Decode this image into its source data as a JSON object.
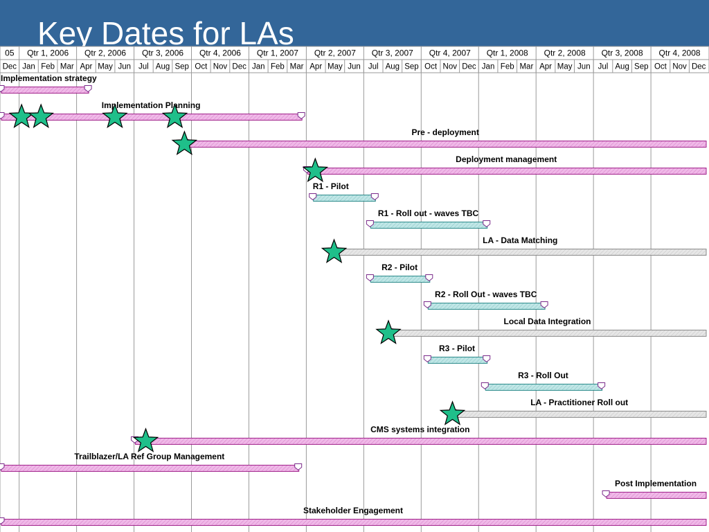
{
  "slide": {
    "title": "Key Dates for LAs"
  },
  "colors": {
    "title_bar": "#336699",
    "title_text": "#ffffff",
    "grid": "#9a9a9a",
    "strategic_fill": "#f0b8e8",
    "strategic_stroke": "#a0208a",
    "release_fill": "#bfe6e6",
    "release_stroke": "#2a8a8a",
    "local_fill": "#e6e6e6",
    "local_stroke": "#8a8a8a",
    "milestone_fill": "#1fbf8a",
    "milestone_stroke": "#000000"
  },
  "chart_data": {
    "type": "gantt",
    "title": "Key Dates for LAs",
    "quarter_labels": [
      "05",
      "Qtr 1, 2006",
      "Qtr 2, 2006",
      "Qtr 3, 2006",
      "Qtr 4, 2006",
      "Qtr 1, 2007",
      "Qtr 2, 2007",
      "Qtr 3, 2007",
      "Qtr 4, 2007",
      "Qtr 1, 2008",
      "Qtr 2, 2008",
      "Qtr 3, 2008",
      "Qtr 4, 2008"
    ],
    "month_labels": [
      "Dec",
      "Jan",
      "Feb",
      "Mar",
      "Apr",
      "May",
      "Jun",
      "Jul",
      "Aug",
      "Sep",
      "Oct",
      "Nov",
      "Dec",
      "Jan",
      "Feb",
      "Mar",
      "Apr",
      "May",
      "Jun",
      "Jul",
      "Aug",
      "Sep",
      "Oct",
      "Nov",
      "Dec",
      "Jan",
      "Feb",
      "Mar",
      "Apr",
      "May",
      "Jun",
      "Jul",
      "Aug",
      "Sep",
      "Oct",
      "Nov",
      "Dec"
    ],
    "axis_start": "2005-12-01",
    "axis_end": "2008-12-31",
    "tasks": [
      {
        "name": "Implementation strategy",
        "start": "2005-12-01",
        "end": "2006-04-20",
        "style": "strategic",
        "label_pos": "left"
      },
      {
        "name": "Implementation Planning",
        "start": "2005-12-01",
        "end": "2007-03-25",
        "style": "strategic",
        "label_pos": "center"
      },
      {
        "name": "Pre - deployment",
        "start": "2006-09-20",
        "end": "2008-12-31",
        "style": "strategic",
        "label_pos": "center"
      },
      {
        "name": "Deployment management",
        "start": "2007-04-01",
        "end": "2008-12-31",
        "style": "strategic",
        "label_pos": "center"
      },
      {
        "name": "R1 - Pilot",
        "start": "2007-04-10",
        "end": "2007-07-20",
        "style": "release",
        "label_pos": "left"
      },
      {
        "name": "R1 - Roll out - waves TBC",
        "start": "2007-07-10",
        "end": "2008-01-15",
        "style": "release",
        "label_pos": "center"
      },
      {
        "name": "LA - Data Matching",
        "start": "2007-05-15",
        "end": "2008-12-31",
        "style": "local",
        "label_pos": "center"
      },
      {
        "name": "R2 - Pilot",
        "start": "2007-07-10",
        "end": "2007-10-15",
        "style": "release",
        "label_pos": "center"
      },
      {
        "name": "R2 - Roll Out - waves TBC",
        "start": "2007-10-10",
        "end": "2008-04-15",
        "style": "release",
        "label_pos": "center"
      },
      {
        "name": "Local Data Integration",
        "start": "2007-08-10",
        "end": "2008-12-31",
        "style": "local",
        "label_pos": "center"
      },
      {
        "name": "R3 - Pilot",
        "start": "2007-10-10",
        "end": "2008-01-15",
        "style": "release",
        "label_pos": "center"
      },
      {
        "name": "R3 - Roll Out",
        "start": "2008-01-10",
        "end": "2008-07-15",
        "style": "release",
        "label_pos": "center"
      },
      {
        "name": "LA - Practitioner Roll out",
        "start": "2007-11-20",
        "end": "2008-12-31",
        "style": "local",
        "label_pos": "center"
      },
      {
        "name": "CMS systems integration",
        "start": "2006-07-01",
        "end": "2008-12-31",
        "style": "strategic",
        "label_pos": "center"
      },
      {
        "name": "Trailblazer/LA Ref Group Management",
        "start": "2005-12-01",
        "end": "2007-03-20",
        "style": "strategic",
        "label_pos": "center"
      },
      {
        "name": "Post Implementation",
        "start": "2008-07-20",
        "end": "2008-12-31",
        "style": "strategic",
        "label_pos": "center"
      },
      {
        "name": "Stakeholder Engagement",
        "start": "2005-12-01",
        "end": "2008-12-31",
        "style": "strategic",
        "label_pos": "center"
      }
    ],
    "milestones": [
      {
        "date": "2006-01-05",
        "task_index": 1
      },
      {
        "date": "2006-02-05",
        "task_index": 1
      },
      {
        "date": "2006-06-01",
        "task_index": 1
      },
      {
        "date": "2006-09-05",
        "task_index": 1
      },
      {
        "date": "2006-09-20",
        "task_index": 2
      },
      {
        "date": "2007-04-15",
        "task_index": 3
      },
      {
        "date": "2007-05-15",
        "task_index": 6
      },
      {
        "date": "2007-08-10",
        "task_index": 9
      },
      {
        "date": "2007-11-20",
        "task_index": 12
      },
      {
        "date": "2006-07-20",
        "task_index": 13
      }
    ]
  }
}
